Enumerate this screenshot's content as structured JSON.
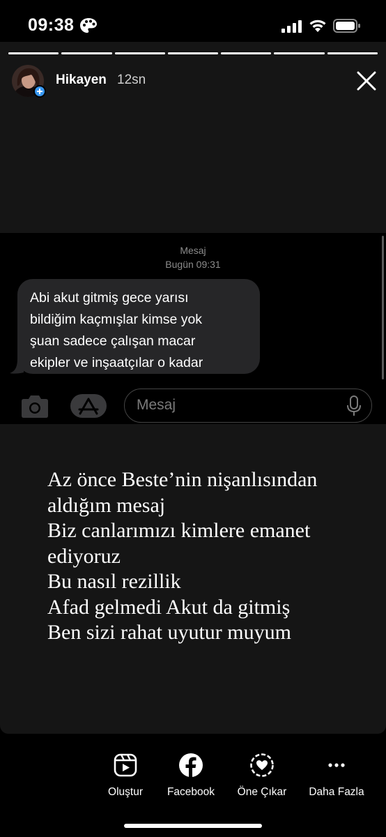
{
  "status_bar": {
    "time": "09:38",
    "icons": [
      "palette-icon",
      "signal-icon",
      "wifi-icon",
      "battery-icon"
    ]
  },
  "story": {
    "progress_segments": 7,
    "progress_filled": 7,
    "username": "Hikayen",
    "time_ago": "12sn",
    "avatar_badge": "add-story-icon"
  },
  "message_screenshot": {
    "header_title": "Mesaj",
    "header_date": "Bugün 09:31",
    "bubble_lines": [
      "Abi akut gitmiş gece yarısı",
      "bildiğim kaçmışlar kimse yok",
      "şuan sadece çalışan macar",
      "ekipler ve inşaatçılar o kadar"
    ],
    "input_placeholder": "Mesaj",
    "colors": {
      "bubble": "#262628",
      "background": "#000000"
    }
  },
  "caption_lines": [
    "Az önce Beste’nin nişanlısından",
    "aldığım mesaj",
    "Biz canlarımızı kimlere emanet",
    "ediyoruz",
    "Bu nasıl rezillik",
    "Afad gelmedi Akut da gitmiş",
    "Ben sizi rahat uyutur muyum"
  ],
  "actions": [
    {
      "label": "Oluştur",
      "icon": "reels-icon"
    },
    {
      "label": "Facebook",
      "icon": "facebook-icon"
    },
    {
      "label": "Öne Çıkar",
      "icon": "highlight-heart-icon"
    },
    {
      "label": "Daha Fazla",
      "icon": "more-icon"
    }
  ]
}
